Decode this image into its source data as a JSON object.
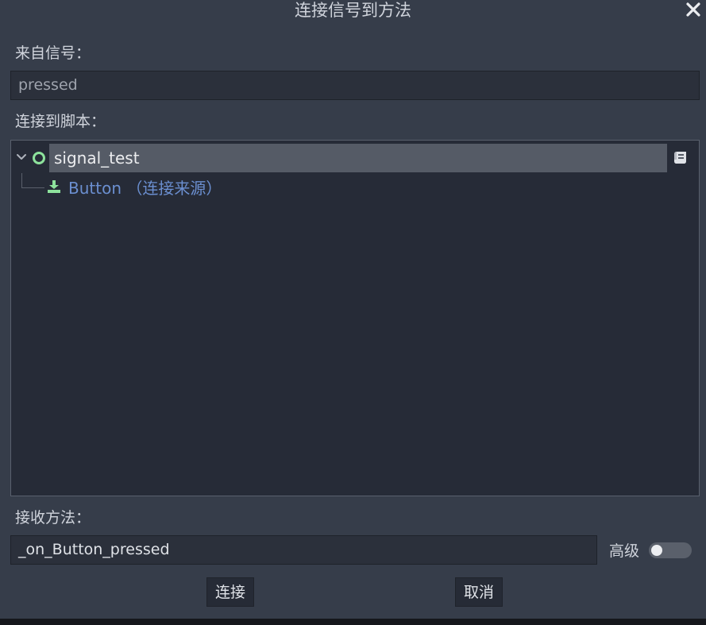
{
  "dialog": {
    "title": "连接信号到方法"
  },
  "signal": {
    "label": "来自信号：",
    "value": "pressed"
  },
  "script": {
    "label": "连接到脚本：",
    "tree": {
      "root": {
        "label": "signal_test",
        "icon": "node-ring-icon"
      },
      "child": {
        "label": "Button （连接来源）",
        "icon": "button-node-icon"
      }
    }
  },
  "method": {
    "label": "接收方法：",
    "value": "_on_Button_pressed"
  },
  "advanced": {
    "label": "高级",
    "enabled": false
  },
  "buttons": {
    "connect": "连接",
    "cancel": "取消"
  },
  "colors": {
    "dialog_bg": "#363d4a",
    "tree_bg": "#262b37",
    "selection": "#555b66",
    "child_text": "#6b8fd0",
    "node_icon": "#8de29c"
  }
}
